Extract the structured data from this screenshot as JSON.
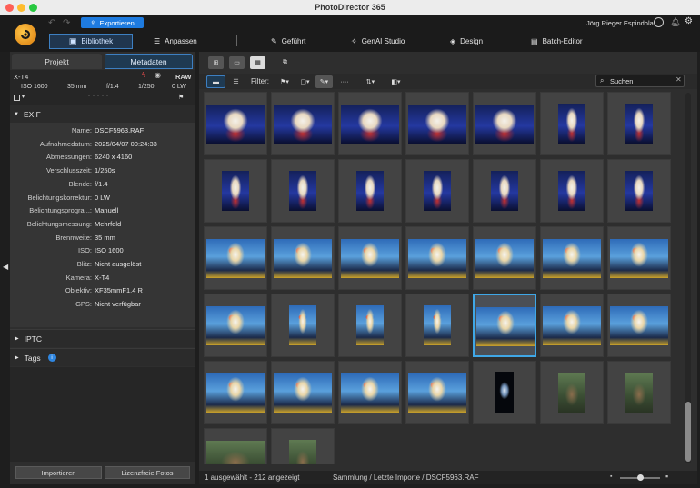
{
  "app_title": "PhotoDirector 365",
  "header": {
    "export_label": "Exportieren",
    "user_name": "Jörg Rieger Espindola",
    "modes": [
      "Bibliothek",
      "Anpassen",
      "Geführt",
      "GenAI Studio",
      "Design",
      "Batch-Editor"
    ],
    "active_mode": "Bibliothek"
  },
  "left_panel": {
    "tabs": [
      "Projekt",
      "Metadaten"
    ],
    "active_tab": "Metadaten",
    "camera": {
      "model": "X-T4",
      "format": "RAW",
      "iso": "ISO 1600",
      "focal": "35 mm",
      "aperture": "f/1.4",
      "shutter": "1/250",
      "ev": "0 LW"
    },
    "exif_title": "EXIF",
    "exif": [
      {
        "key": "Name:",
        "value": "DSCF5963.RAF"
      },
      {
        "key": "Aufnahmedatum:",
        "value": "2025/04/07 00:24:33"
      },
      {
        "key": "Abmessungen:",
        "value": "6240 x 4160"
      },
      {
        "key": "Verschlusszeit:",
        "value": "1/250s"
      },
      {
        "key": "Blende:",
        "value": "f/1.4"
      },
      {
        "key": "Belichtungskorrektur:",
        "value": "0 LW"
      },
      {
        "key": "Belichtungsprogra...:",
        "value": "Manuell"
      },
      {
        "key": "Belichtungsmessung:",
        "value": "Mehrfeld"
      },
      {
        "key": "Brennweite:",
        "value": "35 mm"
      },
      {
        "key": "ISO:",
        "value": "ISO 1600"
      },
      {
        "key": "Blitz:",
        "value": "Nicht ausgelöst"
      },
      {
        "key": "Kamera:",
        "value": "X-T4"
      },
      {
        "key": "Objektiv:",
        "value": "XF35mmF1.4 R"
      },
      {
        "key": "GPS:",
        "value": "Nicht verfügbar"
      }
    ],
    "sections": [
      "IPTC",
      "Tags"
    ],
    "import_label": "Importieren",
    "stock_label": "Lizenzfreie Fotos"
  },
  "toolbar": {
    "filter_label": "Filter:",
    "search_placeholder": "Suchen"
  },
  "grid": {
    "selected_index": 25,
    "thumbs": [
      "show-l",
      "show-l",
      "show-l",
      "show-l",
      "show-l",
      "show-p",
      "show-p",
      "show-p",
      "show-p",
      "show-p",
      "show-p",
      "show-p",
      "show-p",
      "show-p",
      "dance-l",
      "dance-l",
      "dance-l",
      "dance-l",
      "dance-l",
      "dance-l",
      "dance-l",
      "dance-l",
      "dance-p",
      "dance-p",
      "dance-p",
      "dance-l",
      "dance-l",
      "dance-l",
      "dance-l",
      "dance-l",
      "dance-l",
      "dance-l",
      "dark-p",
      "forest-p",
      "forest-p",
      "forest-l",
      "forest-p"
    ]
  },
  "status": {
    "selection": "1 ausgewählt - 212 angezeigt",
    "path": "Sammlung / Letzte Importe / DSCF5963.RAF",
    "zoom": 0.5
  },
  "colors": {
    "accent": "#3fa7e6",
    "export_button": "#1e7be0",
    "logo": "#f0a020"
  }
}
